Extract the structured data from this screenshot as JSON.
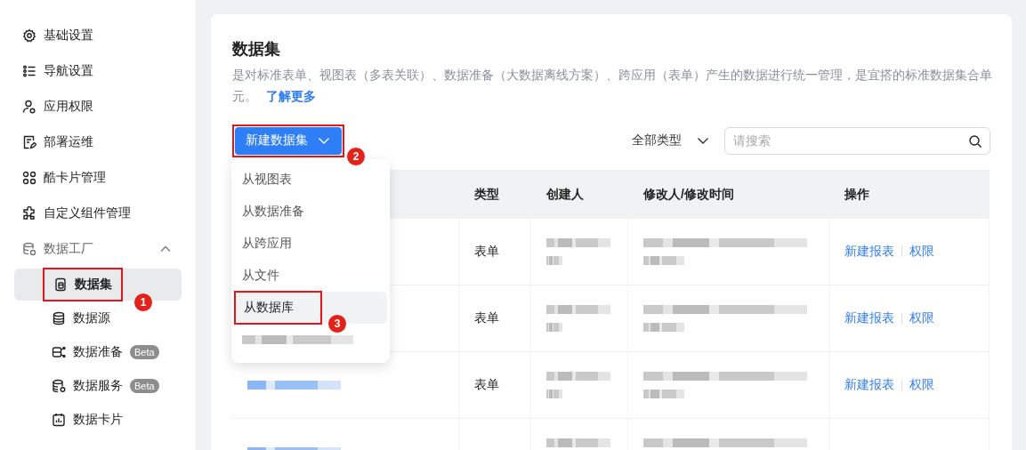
{
  "sidebar": {
    "items": [
      {
        "label": "基础设置",
        "kind": "item"
      },
      {
        "label": "导航设置",
        "kind": "item"
      },
      {
        "label": "应用权限",
        "kind": "item"
      },
      {
        "label": "部署运维",
        "kind": "item"
      },
      {
        "label": "酷卡片管理",
        "kind": "item"
      },
      {
        "label": "自定义组件管理",
        "kind": "item"
      },
      {
        "label": "数据工厂",
        "kind": "group",
        "expanded": true,
        "children": [
          {
            "label": "数据集",
            "selected": true,
            "annotation": "1"
          },
          {
            "label": "数据源",
            "selected": false
          },
          {
            "label": "数据准备",
            "badge": "Beta",
            "selected": false
          },
          {
            "label": "数据服务",
            "badge": "Beta",
            "selected": false
          },
          {
            "label": "数据卡片",
            "selected": false
          }
        ]
      }
    ]
  },
  "panel": {
    "title": "数据集",
    "description": "是对标准表单、视图表（多表关联）、数据准备（大数据离线方案）、跨应用（表单）产生的数据进行统一管理，是宜搭的标准数据集合单元。",
    "link": "了解更多",
    "new_button": {
      "label": "新建数据集",
      "annotation": "2"
    },
    "type_filter": "全部类型",
    "search": {
      "placeholder": "请搜索"
    },
    "dropdown": {
      "items": [
        {
          "label": "从视图表",
          "selected": false
        },
        {
          "label": "从数据准备",
          "selected": false
        },
        {
          "label": "从跨应用",
          "selected": false
        },
        {
          "label": "从文件",
          "selected": false
        },
        {
          "label": "从数据库",
          "selected": true,
          "annotation": "3"
        }
      ]
    },
    "table": {
      "columns": [
        "类型",
        "创建人",
        "修改人/修改时间",
        "操作"
      ],
      "rows": [
        {
          "type": "表单",
          "actions": [
            "新建报表",
            "权限"
          ]
        },
        {
          "type": "表单",
          "actions": [
            "新建报表",
            "权限"
          ]
        },
        {
          "type": "表单",
          "actions": [
            "新建报表",
            "权限"
          ]
        }
      ]
    }
  }
}
